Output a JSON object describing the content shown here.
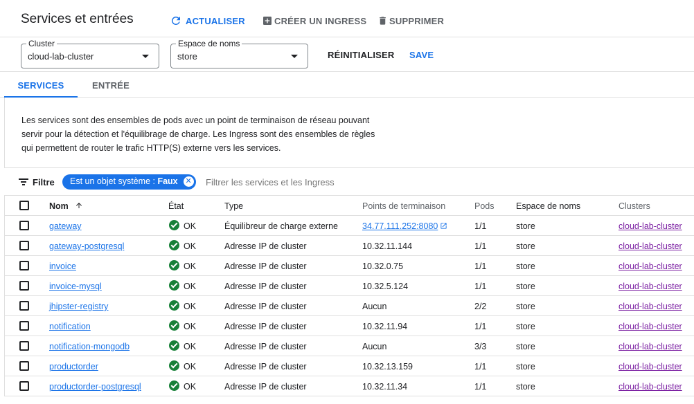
{
  "header": {
    "title": "Services et entrées",
    "refresh_label": "ACTUALISER",
    "create_label": "CRÉER UN INGRESS",
    "delete_label": "SUPPRIMER"
  },
  "filters": {
    "cluster_label": "Cluster",
    "cluster_value": "cloud-lab-cluster",
    "namespace_label": "Espace de noms",
    "namespace_value": "store",
    "reset_label": "RÉINITIALISER",
    "save_label": "SAVE"
  },
  "tabs": [
    {
      "label": "SERVICES",
      "active": true
    },
    {
      "label": "ENTRÉE",
      "active": false
    }
  ],
  "description": "Les services sont des ensembles de pods avec un point de terminaison de réseau pouvant servir pour la détection et l'équilibrage de charge. Les Ingress sont des ensembles de règles qui permettent de router le trafic HTTP(S) externe vers les services.",
  "filterbar": {
    "label": "Filtre",
    "chip_prefix": "Est un objet système : ",
    "chip_value": "Faux",
    "placeholder": "Filtrer les services et les Ingress"
  },
  "table": {
    "headers": {
      "name": "Nom",
      "status": "État",
      "type": "Type",
      "endpoints": "Points de terminaison",
      "pods": "Pods",
      "namespace": "Espace de noms",
      "clusters": "Clusters"
    },
    "rows": [
      {
        "name": "gateway",
        "status": "OK",
        "type": "Équilibreur de charge externe",
        "endpoints": "34.77.111.252:8080",
        "endpoint_link": true,
        "pods": "1/1",
        "namespace": "store",
        "cluster": "cloud-lab-cluster"
      },
      {
        "name": "gateway-postgresql",
        "status": "OK",
        "type": "Adresse IP de cluster",
        "endpoints": "10.32.11.144",
        "endpoint_link": false,
        "pods": "1/1",
        "namespace": "store",
        "cluster": "cloud-lab-cluster"
      },
      {
        "name": "invoice",
        "status": "OK",
        "type": "Adresse IP de cluster",
        "endpoints": "10.32.0.75",
        "endpoint_link": false,
        "pods": "1/1",
        "namespace": "store",
        "cluster": "cloud-lab-cluster"
      },
      {
        "name": "invoice-mysql",
        "status": "OK",
        "type": "Adresse IP de cluster",
        "endpoints": "10.32.5.124",
        "endpoint_link": false,
        "pods": "1/1",
        "namespace": "store",
        "cluster": "cloud-lab-cluster"
      },
      {
        "name": "jhipster-registry",
        "status": "OK",
        "type": "Adresse IP de cluster",
        "endpoints": "Aucun",
        "endpoint_link": false,
        "pods": "2/2",
        "namespace": "store",
        "cluster": "cloud-lab-cluster"
      },
      {
        "name": "notification",
        "status": "OK",
        "type": "Adresse IP de cluster",
        "endpoints": "10.32.11.94",
        "endpoint_link": false,
        "pods": "1/1",
        "namespace": "store",
        "cluster": "cloud-lab-cluster"
      },
      {
        "name": "notification-mongodb",
        "status": "OK",
        "type": "Adresse IP de cluster",
        "endpoints": "Aucun",
        "endpoint_link": false,
        "pods": "3/3",
        "namespace": "store",
        "cluster": "cloud-lab-cluster"
      },
      {
        "name": "productorder",
        "status": "OK",
        "type": "Adresse IP de cluster",
        "endpoints": "10.32.13.159",
        "endpoint_link": false,
        "pods": "1/1",
        "namespace": "store",
        "cluster": "cloud-lab-cluster"
      },
      {
        "name": "productorder-postgresql",
        "status": "OK",
        "type": "Adresse IP de cluster",
        "endpoints": "10.32.11.34",
        "endpoint_link": false,
        "pods": "1/1",
        "namespace": "store",
        "cluster": "cloud-lab-cluster"
      }
    ]
  },
  "colors": {
    "accent": "#1a73e8",
    "ok": "#188038",
    "cluster_link": "#7b1fa2"
  }
}
